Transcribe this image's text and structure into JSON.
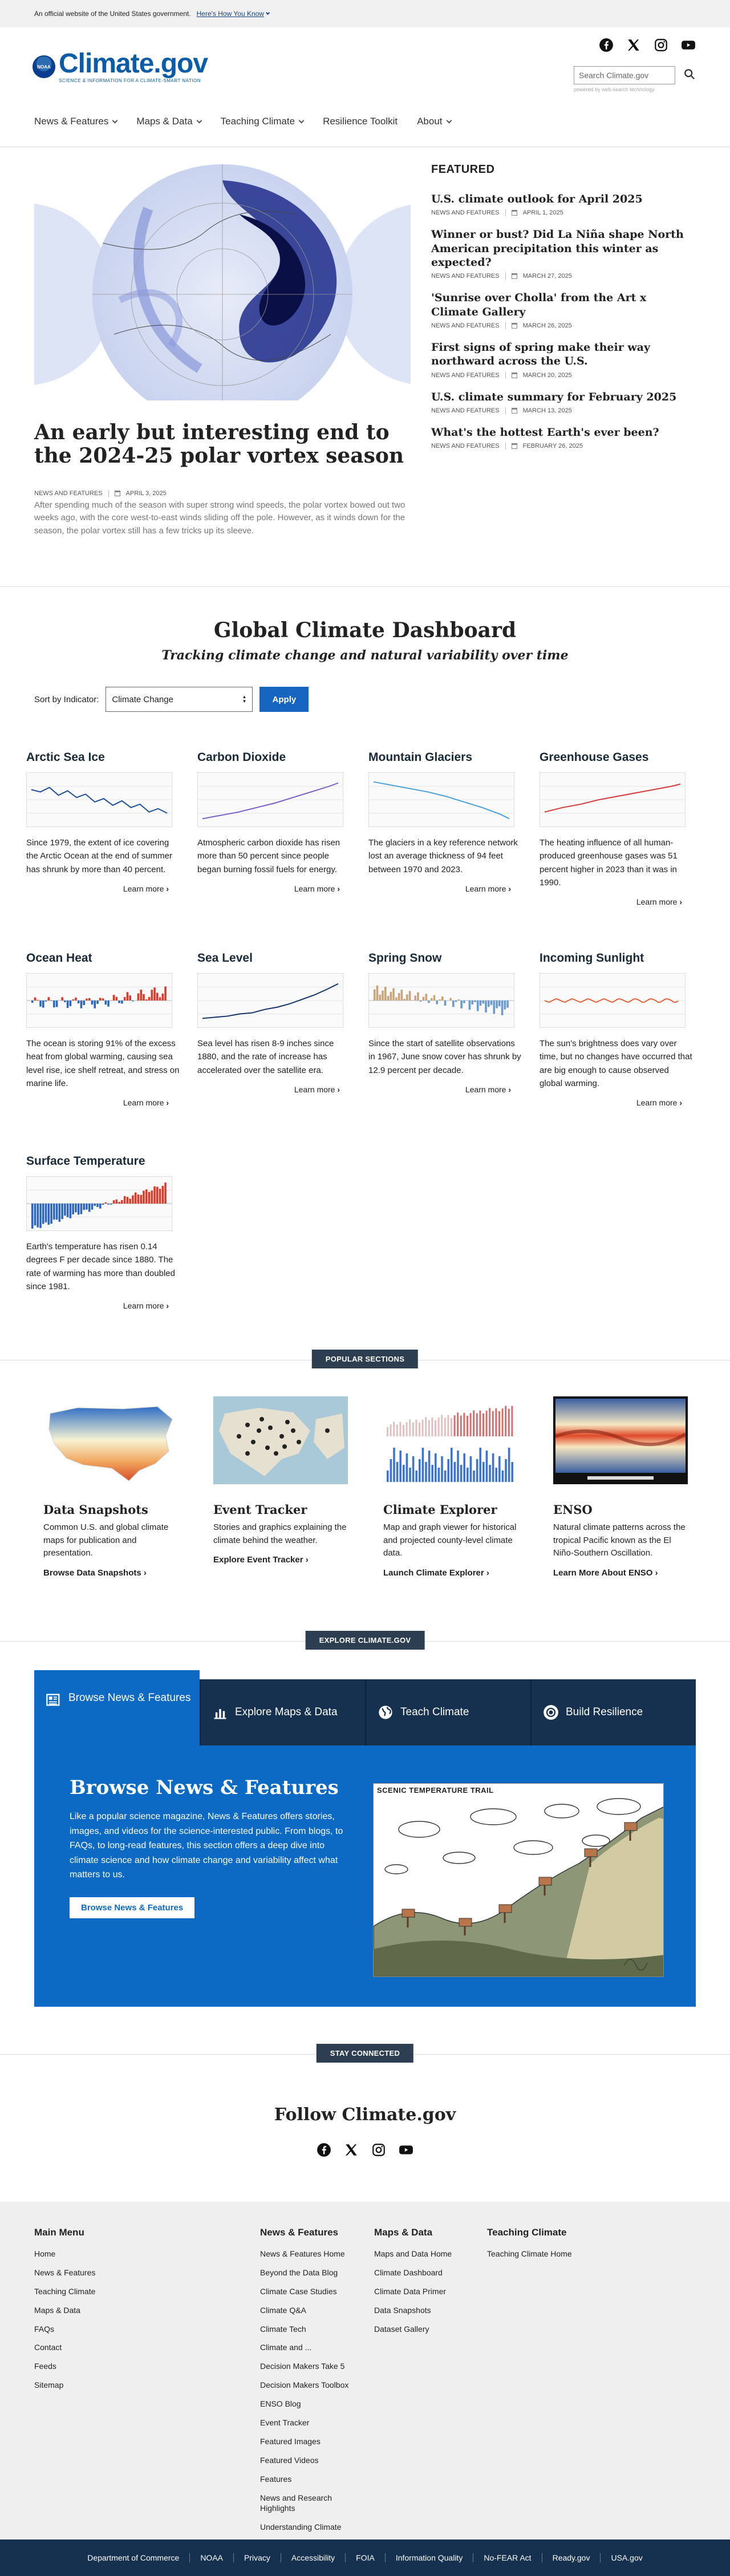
{
  "gov_banner": {
    "text": "An official website of the United States government.",
    "link": "Here's How You Know"
  },
  "logo": {
    "badge": "NOAA",
    "name": "Climate.gov",
    "tagline": "SCIENCE & INFORMATION FOR A CLIMATE-SMART NATION"
  },
  "search": {
    "placeholder": "Search Climate.gov",
    "powered": "powered by web-search technology"
  },
  "social": [
    "facebook-icon",
    "x-icon",
    "instagram-icon",
    "youtube-icon"
  ],
  "nav": [
    {
      "label": "News & Features",
      "dropdown": true
    },
    {
      "label": "Maps & Data",
      "dropdown": true
    },
    {
      "label": "Teaching Climate",
      "dropdown": true
    },
    {
      "label": "Resilience Toolkit",
      "dropdown": false
    },
    {
      "label": "About",
      "dropdown": true
    }
  ],
  "hero": {
    "title": "An early but interesting end to the 2024-25 polar vortex season",
    "category": "NEWS AND FEATURES",
    "date": "APRIL 3, 2025",
    "description": "After spending much of the season with super strong wind speeds, the polar vortex bowed out two weeks ago, with the core west-to-east winds sliding off the pole. However, as it winds down for the season, the polar vortex still has a few tricks up its sleeve."
  },
  "featured": {
    "heading": "FEATURED",
    "items": [
      {
        "title": "U.S. climate outlook for April 2025",
        "category": "NEWS AND FEATURES",
        "date": "APRIL 1, 2025"
      },
      {
        "title": "Winner or bust? Did La Niña shape North American precipitation this winter as expected?",
        "category": "NEWS AND FEATURES",
        "date": "MARCH 27, 2025"
      },
      {
        "title": "'Sunrise over Cholla' from the Art x Climate Gallery",
        "category": "NEWS AND FEATURES",
        "date": "MARCH 26, 2025"
      },
      {
        "title": "First signs of spring make their way northward across the U.S.",
        "category": "NEWS AND FEATURES",
        "date": "MARCH 20, 2025"
      },
      {
        "title": "U.S. climate summary for February 2025",
        "category": "NEWS AND FEATURES",
        "date": "MARCH 13, 2025"
      },
      {
        "title": "What's the hottest Earth's ever been?",
        "category": "NEWS AND FEATURES",
        "date": "FEBRUARY 26, 2025"
      }
    ]
  },
  "dashboard": {
    "title": "Global Climate Dashboard",
    "subtitle": "Tracking climate change and natural variability over time",
    "sort_label": "Sort by Indicator:",
    "sort_value": "Climate Change",
    "apply": "Apply",
    "learn_more": "Learn more",
    "cards": [
      {
        "title": "Arctic Sea Ice",
        "text": "Since 1979, the extent of ice covering the Arctic Ocean at the end of summer has shrunk by more than 40 percent.",
        "chart": "line-down-blue"
      },
      {
        "title": "Carbon Dioxide",
        "text": "Atmospheric carbon dioxide has risen more than 50 percent since people began burning fossil fuels for energy.",
        "chart": "line-up-purple"
      },
      {
        "title": "Mountain Glaciers",
        "text": "The glaciers in a key reference network lost an average thickness of 94 feet between 1970 and 2023.",
        "chart": "line-down-lightblue"
      },
      {
        "title": "Greenhouse Gases",
        "text": "The heating influence of all human-produced greenhouse gases was 51 percent higher in 2023 than it was in 1990.",
        "chart": "line-up-red"
      },
      {
        "title": "Ocean Heat",
        "text": "The ocean is storing 91% of the excess heat from global warming, causing sea level rise, ice shelf retreat, and stress on marine life.",
        "chart": "bars-blue-red"
      },
      {
        "title": "Sea Level",
        "text": "Sea level has risen 8-9 inches since 1880, and the rate of increase has accelerated over the satellite era.",
        "chart": "line-up-navy"
      },
      {
        "title": "Spring Snow",
        "text": "Since the start of satellite observations in 1967, June snow cover has shrunk by 12.9 percent per decade.",
        "chart": "bars-blue-tan"
      },
      {
        "title": "Incoming Sunlight",
        "text": "The sun's brightness does vary over time, but no changes have occurred that are big enough to cause observed global warming.",
        "chart": "line-flat-orange"
      },
      {
        "title": "Surface Temperature",
        "text": "Earth's temperature has risen 0.14 degrees F per decade since 1880. The rate of warming has more than doubled since 1981.",
        "chart": "bars-blue-red-up"
      }
    ]
  },
  "popular": {
    "tag": "POPULAR SECTIONS",
    "items": [
      {
        "title": "Data Snapshots",
        "text": "Common U.S. and global climate maps for publication and presentation.",
        "link": "Browse Data Snapshots"
      },
      {
        "title": "Event Tracker",
        "text": "Stories and graphics explaining the climate behind the weather.",
        "link": "Explore Event Tracker"
      },
      {
        "title": "Climate Explorer",
        "text": "Map and graph viewer for historical and projected county-level climate data.",
        "link": "Launch Climate Explorer"
      },
      {
        "title": "ENSO",
        "text": "Natural climate patterns across the tropical Pacific known as the El Niño-Southern Oscillation.",
        "link": "Learn More About ENSO"
      }
    ]
  },
  "explore": {
    "tag": "EXPLORE CLIMATE.GOV",
    "tabs": [
      {
        "label": "Browse News & Features",
        "icon": "newspaper-icon"
      },
      {
        "label": "Explore Maps & Data",
        "icon": "bar-chart-icon"
      },
      {
        "label": "Teach Climate",
        "icon": "globe-icon"
      },
      {
        "label": "Build Resilience",
        "icon": "lifebuoy-icon"
      }
    ],
    "heading": "Browse News & Features",
    "text": "Like a popular science magazine, News & Features offers stories, images, and videos for the science-interested public. From blogs, to FAQs, to long-read features, this section offers a deep dive into climate science and how climate change and variability affect what matters to us.",
    "button": "Browse News & Features",
    "comic_title": "SCENIC TEMPERATURE TRAIL"
  },
  "follow": {
    "tag": "STAY CONNECTED",
    "title": "Follow Climate.gov"
  },
  "footer": {
    "columns": [
      {
        "heading": "Main Menu",
        "items": [
          "Home",
          "News & Features",
          "Teaching Climate",
          "Maps & Data",
          "FAQs",
          "Contact",
          "Feeds",
          "Sitemap"
        ]
      },
      {
        "heading": "News & Features",
        "items": [
          "News & Features Home",
          "Beyond the Data Blog",
          "Climate Case Studies",
          "Climate Q&A",
          "Climate Tech",
          "Climate and ...",
          "Decision Makers Take 5",
          "Decision Makers Toolbox",
          "ENSO Blog",
          "Event Tracker",
          "Featured Images",
          "Featured Videos",
          "Features",
          "News and Research Highlights",
          "Understanding Climate"
        ]
      },
      {
        "heading": "Maps & Data",
        "items": [
          "Maps and Data Home",
          "Climate Dashboard",
          "Climate Data Primer",
          "Data Snapshots",
          "Dataset Gallery"
        ]
      },
      {
        "heading": "Teaching Climate",
        "items": [
          "Teaching Climate Home"
        ]
      }
    ],
    "bottom": [
      "Department of Commerce",
      "NOAA",
      "Privacy",
      "Accessibility",
      "FOIA",
      "Information Quality",
      "No-FEAR Act",
      "Ready.gov",
      "USA.gov"
    ]
  }
}
